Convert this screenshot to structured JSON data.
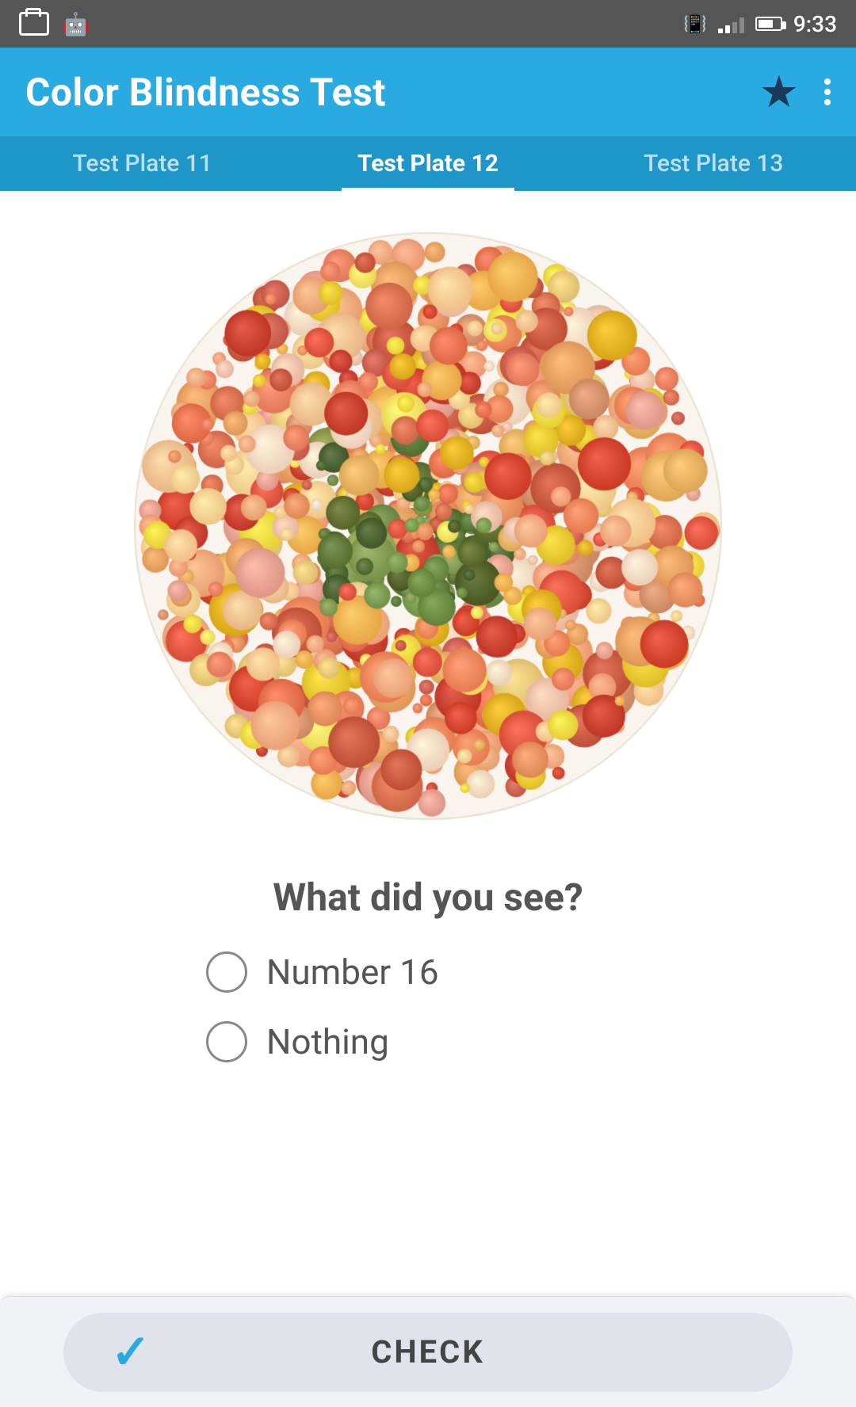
{
  "statusBar": {
    "time": "9:33",
    "icons": [
      "screenshot",
      "android",
      "vibrate",
      "signal",
      "battery"
    ]
  },
  "appBar": {
    "title": "Color Blindness Test",
    "starLabel": "star",
    "moreLabel": "more options"
  },
  "tabs": [
    {
      "id": "tab-11",
      "label": "Test Plate 11",
      "active": false
    },
    {
      "id": "tab-12",
      "label": "Test Plate 12",
      "active": true
    },
    {
      "id": "tab-13",
      "label": "Test Plate 13",
      "active": false
    }
  ],
  "question": "What did you see?",
  "options": [
    {
      "id": "opt-number16",
      "label": "Number 16",
      "selected": false
    },
    {
      "id": "opt-nothing",
      "label": "Nothing",
      "selected": false
    }
  ],
  "checkButton": {
    "tick": "✓",
    "label": "CHECK"
  },
  "plate": {
    "description": "Ishihara color blindness test plate 12 - number 16"
  }
}
